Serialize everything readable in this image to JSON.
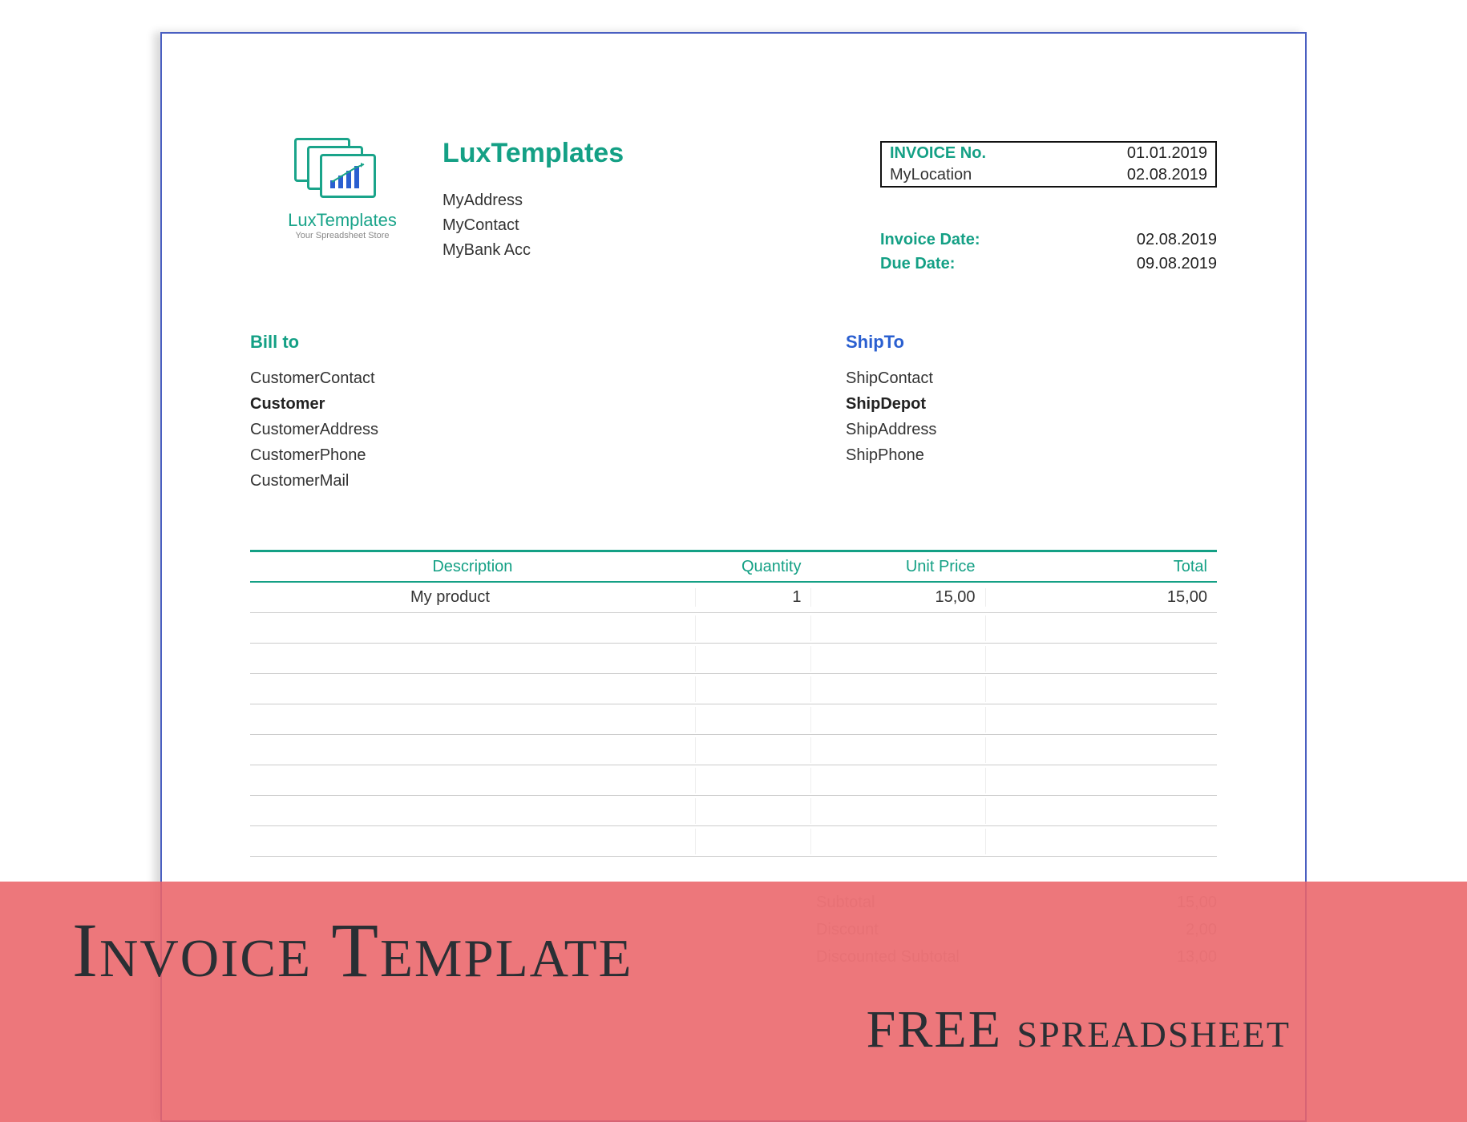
{
  "logo": {
    "brand": "LuxTemplates",
    "tagline": "Your Spreadsheet Store"
  },
  "company": {
    "name": "LuxTemplates",
    "address": "MyAddress",
    "contact": "MyContact",
    "bank": "MyBank Acc"
  },
  "invoice_box": {
    "label_no": "INVOICE No.",
    "value_no": "01.01.2019",
    "label_loc": "MyLocation",
    "value_loc": "02.08.2019"
  },
  "dates": {
    "invoice_label": "Invoice Date:",
    "invoice_value": "02.08.2019",
    "due_label": "Due Date:",
    "due_value": "09.08.2019"
  },
  "bill_to": {
    "title": "Bill to",
    "contact": "CustomerContact",
    "name": "Customer",
    "address": "CustomerAddress",
    "phone": "CustomerPhone",
    "mail": "CustomerMail"
  },
  "ship_to": {
    "title": "ShipTo",
    "contact": "ShipContact",
    "name": "ShipDepot",
    "address": "ShipAddress",
    "phone": "ShipPhone"
  },
  "table": {
    "headers": {
      "description": "Description",
      "quantity": "Quantity",
      "unit_price": "Unit Price",
      "total": "Total"
    },
    "rows": [
      {
        "description": "My product",
        "quantity": "1",
        "unit_price": "15,00",
        "total": "15,00"
      }
    ]
  },
  "summary": {
    "subtotal_label": "Subtotal",
    "subtotal_value": "15,00",
    "discount_label": "Discount",
    "discount_value": "2,00",
    "discounted_label": "Discounted Subtotal",
    "discounted_value": "13,00"
  },
  "banner": {
    "title": "Invoice Template",
    "subtitle": "FREE spreadsheet"
  }
}
